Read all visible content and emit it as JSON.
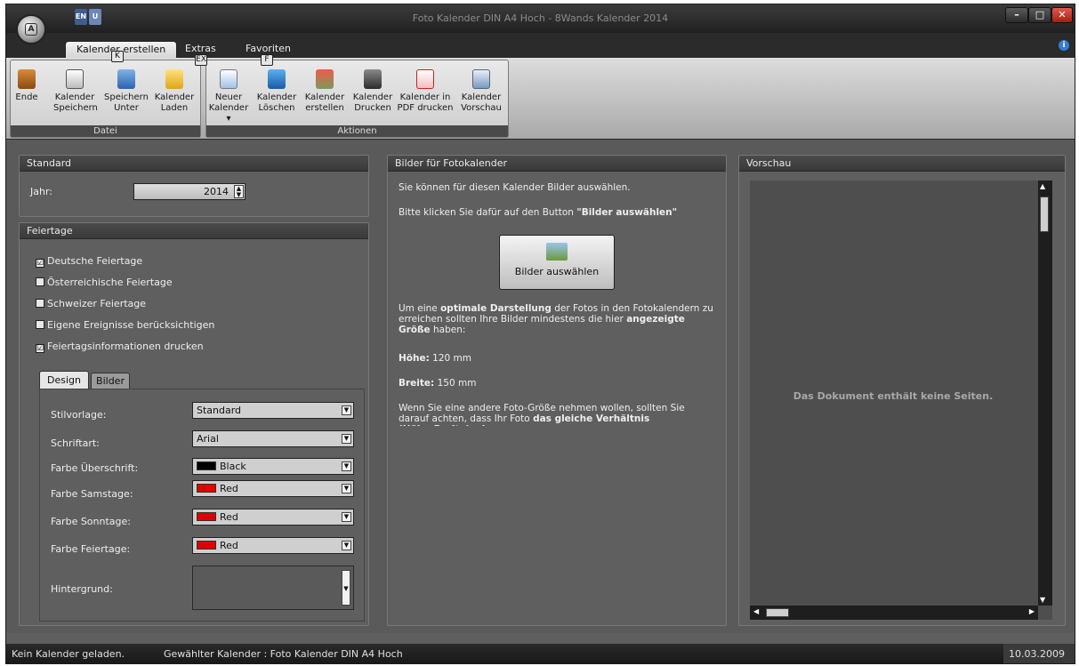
{
  "window": {
    "title": "Foto Kalender DIN A4 Hoch - 8Wands Kalender 2014",
    "controls": {
      "minimize": "–",
      "maximize": "□",
      "close": "✕"
    }
  },
  "app_button_label": "A",
  "qat": {
    "en": "EN",
    "u": "U"
  },
  "tabs": [
    {
      "label": "Kalender erstellen",
      "keytip": "K"
    },
    {
      "label": "Extras",
      "keytip": "EX"
    },
    {
      "label": "Favoriten",
      "keytip": "F"
    }
  ],
  "ribbon": {
    "datei": {
      "caption": "Datei",
      "buttons": [
        {
          "label1": "Ende",
          "label2": "",
          "icon": "door-icon"
        },
        {
          "label1": "Kalender",
          "label2": "Speichern",
          "icon": "save-icon"
        },
        {
          "label1": "Speichern",
          "label2": "Unter",
          "icon": "save-as-icon"
        },
        {
          "label1": "Kalender",
          "label2": "Laden",
          "icon": "folder-icon"
        }
      ]
    },
    "aktionen": {
      "caption": "Aktionen",
      "buttons": [
        {
          "label1": "Neuer",
          "label2": "Kalender ▾",
          "icon": "new-document-icon"
        },
        {
          "label1": "Kalender",
          "label2": "Löschen",
          "icon": "trash-icon"
        },
        {
          "label1": "Kalender",
          "label2": "erstellen",
          "icon": "calendar-icon"
        },
        {
          "label1": "Kalender",
          "label2": "Drucken",
          "icon": "printer-icon"
        },
        {
          "label1": "Kalender in",
          "label2": "PDF drucken",
          "icon": "pdf-icon"
        },
        {
          "label1": "Kalender",
          "label2": "Vorschau",
          "icon": "preview-icon"
        }
      ]
    }
  },
  "standard": {
    "header": "Standard",
    "year_label": "Jahr:",
    "year_value": "2014"
  },
  "feiertage": {
    "header": "Feiertage",
    "items": [
      {
        "label": "Deutsche Feiertage",
        "checked": "☑"
      },
      {
        "label": "Österreichische Feiertage",
        "checked": ""
      },
      {
        "label": "Schweizer Feiertage",
        "checked": ""
      },
      {
        "label": "Eigene Ereignisse berücksichtigen",
        "checked": ""
      },
      {
        "label": "Feiertagsinformationen drucken",
        "checked": "☑"
      }
    ]
  },
  "design_tabs": {
    "design": "Design",
    "bilder": "Bilder"
  },
  "design": {
    "rows": [
      {
        "label": "Stilvorlage:",
        "value": "Standard"
      },
      {
        "label": "Schriftart:",
        "value": "Arial"
      },
      {
        "label": "Farbe Überschrift:",
        "value": "Black",
        "color": "#000000"
      },
      {
        "label": "Farbe Samstage:",
        "value": "Red",
        "color": "#e00000"
      },
      {
        "label": "Farbe Sonntage:",
        "value": "Red",
        "color": "#e00000"
      },
      {
        "label": "Farbe Feiertage:",
        "value": "Red",
        "color": "#e00000"
      },
      {
        "label": "Hintergrund:",
        "value": ""
      }
    ]
  },
  "bilder": {
    "header": "Bilder für Fotokalender",
    "line1": "Sie können für diesen Kalender Bilder auswählen.",
    "line2_prefix": "Bitte klicken Sie dafür auf den Button ",
    "line2_bold": "\"Bilder auswählen\"",
    "button": "Bilder auswählen",
    "p1_a": "Um eine ",
    "p1_b": "optimale Darstellung",
    "p1_c": " der Fotos in den Fotokalendern zu erreichen sollten Ihre Bilder mindestens die hier ",
    "p1_d": "angezeigte Größe",
    "p1_e": " haben:",
    "hoehe_label": "Höhe:",
    "hoehe_value": " 120 mm",
    "breite_label": "Breite:",
    "breite_value": " 150 mm",
    "p2_a": "Wenn Sie eine andere Foto-Größe nehmen wollen, sollten Sie darauf achten, dass Ihr Foto ",
    "p2_b": "das gleiche Verhältnis (Höhe:Breite) wie"
  },
  "vorschau": {
    "header": "Vorschau",
    "empty": "Das Dokument enthält keine Seiten."
  },
  "status": {
    "left": "Kein Kalender geladen.",
    "middle": "Gewählter Kalender : Foto Kalender DIN A4 Hoch",
    "date": "10.03.2009"
  },
  "colors": {
    "accent": "#2b2b2b",
    "close": "#c8281e",
    "info": "#3a7bd5"
  }
}
